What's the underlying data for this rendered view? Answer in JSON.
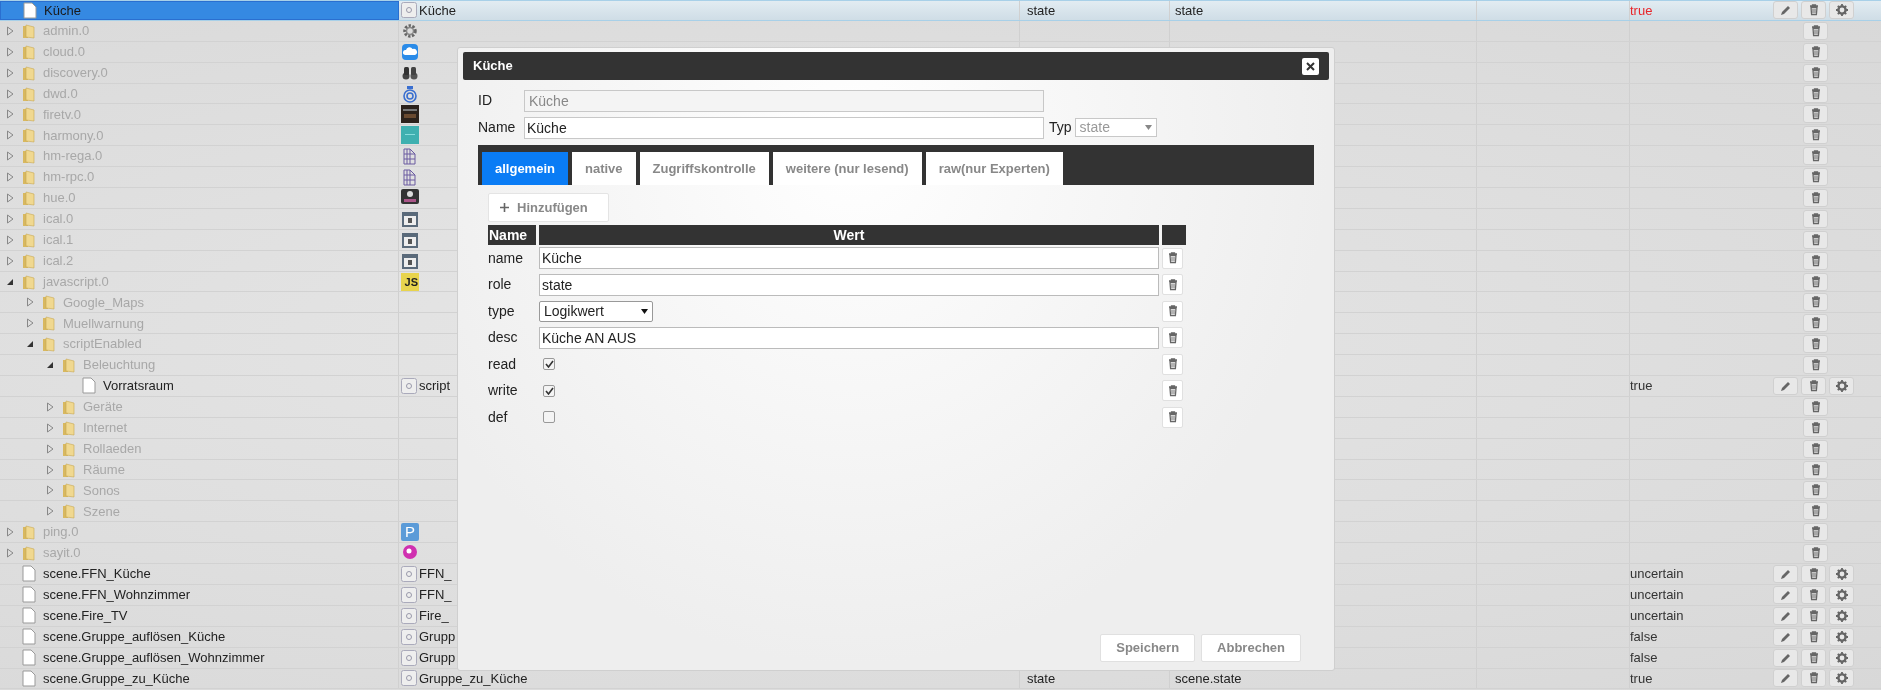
{
  "tree": [
    {
      "label": "Küche",
      "kind": "state",
      "selected": true,
      "name": "Küche",
      "type": "state",
      "role": "state",
      "value": "true",
      "color": "#e8262b"
    },
    {
      "label": "admin.0",
      "kind": "folder",
      "expanded": false,
      "selected": false
    },
    {
      "label": "cloud.0",
      "kind": "folder",
      "expanded": false,
      "selected": false
    },
    {
      "label": "discovery.0",
      "kind": "folder",
      "expanded": false,
      "selected": false
    },
    {
      "label": "dwd.0",
      "kind": "folder",
      "expanded": false,
      "selected": false
    },
    {
      "label": "firetv.0",
      "kind": "folder",
      "expanded": false,
      "selected": false
    },
    {
      "label": "harmony.0",
      "kind": "folder",
      "expanded": false,
      "selected": false
    },
    {
      "label": "hm-rega.0",
      "kind": "folder",
      "expanded": false,
      "selected": false
    },
    {
      "label": "hm-rpc.0",
      "kind": "folder",
      "expanded": false,
      "selected": false
    },
    {
      "label": "hue.0",
      "kind": "folder",
      "expanded": false,
      "selected": false
    },
    {
      "label": "ical.0",
      "kind": "folder",
      "expanded": false,
      "selected": false
    },
    {
      "label": "ical.1",
      "kind": "folder",
      "expanded": false,
      "selected": false
    },
    {
      "label": "ical.2",
      "kind": "folder",
      "expanded": false,
      "selected": false
    },
    {
      "label": "javascript.0",
      "kind": "folder",
      "expanded": true,
      "selected": false,
      "badge": "JS",
      "children": [
        {
          "label": "Google_Maps",
          "kind": "folder",
          "expanded": false,
          "selected": false
        },
        {
          "label": "Muellwarnung",
          "kind": "folder",
          "expanded": false,
          "selected": false
        },
        {
          "label": "scriptEnabled",
          "kind": "folder",
          "expanded": true,
          "selected": false,
          "children": [
            {
              "label": "Beleuchtung",
              "kind": "folder",
              "expanded": true,
              "selected": false,
              "children": [
                {
                  "label": "Vorratsraum",
                  "kind": "state",
                  "selected": false,
                  "name": "script",
                  "value": "true",
                  "color": "#333333"
                }
              ]
            },
            {
              "label": "Geräte",
              "kind": "folder",
              "expanded": false,
              "selected": false
            },
            {
              "label": "Internet",
              "kind": "folder",
              "expanded": false,
              "selected": false
            },
            {
              "label": "Rollaeden",
              "kind": "folder",
              "expanded": false,
              "selected": false
            },
            {
              "label": "Räume",
              "kind": "folder",
              "expanded": false,
              "selected": false
            },
            {
              "label": "Sonos",
              "kind": "folder",
              "expanded": false,
              "selected": false
            },
            {
              "label": "Szene",
              "kind": "folder",
              "expanded": false,
              "selected": false
            }
          ]
        }
      ]
    },
    {
      "label": "ping.0",
      "kind": "folder",
      "expanded": false,
      "selected": false,
      "badge": "P"
    },
    {
      "label": "sayit.0",
      "kind": "folder",
      "expanded": false,
      "selected": false
    },
    {
      "label": "scene.FFN_Küche",
      "kind": "state",
      "selected": false,
      "name": "FFN_",
      "value": "uncertain",
      "color": "#333333"
    },
    {
      "label": "scene.FFN_Wohnzimmer",
      "kind": "state",
      "selected": false,
      "name": "FFN_",
      "value": "uncertain",
      "color": "#333333"
    },
    {
      "label": "scene.Fire_TV",
      "kind": "state",
      "selected": false,
      "name": "Fire_",
      "value": "uncertain",
      "color": "#333333"
    },
    {
      "label": "scene.Gruppe_auflösen_Küche",
      "kind": "state",
      "selected": false,
      "name": "Grupp",
      "value": "false",
      "color": "#333333"
    },
    {
      "label": "scene.Gruppe_auflösen_Wohnzimmer",
      "kind": "state",
      "selected": false,
      "name": "Grupp",
      "value": "false",
      "color": "#333333"
    },
    {
      "label": "scene.Gruppe_zu_Küche",
      "kind": "state",
      "selected": false,
      "name": "Gruppe_zu_Küche",
      "type": "state",
      "role": "scene.state",
      "value": "true",
      "color": "#333333"
    }
  ],
  "dialog": {
    "title": "Küche",
    "id_label": "ID",
    "id_value": "Küche",
    "name_label": "Name",
    "name_value": "Küche",
    "typ_label": "Typ",
    "typ_value": "state",
    "tabs": [
      {
        "label": "allgemein",
        "selected": true
      },
      {
        "label": "native",
        "selected": false
      },
      {
        "label": "Zugriffskontrolle",
        "selected": false
      },
      {
        "label": "weitere (nur lesend)",
        "selected": false
      },
      {
        "label": "raw(nur Experten)",
        "selected": false
      }
    ],
    "add_button": "Hinzufügen",
    "columns": [
      "Name",
      "Wert"
    ],
    "fields": [
      {
        "name": "name",
        "kind": "text",
        "value": "Küche"
      },
      {
        "name": "role",
        "kind": "text",
        "value": "state"
      },
      {
        "name": "type",
        "kind": "select",
        "value": "Logikwert"
      },
      {
        "name": "desc",
        "kind": "text",
        "value": "Küche AN AUS"
      },
      {
        "name": "read",
        "kind": "checkbox",
        "checked": true
      },
      {
        "name": "write",
        "kind": "checkbox",
        "checked": true
      },
      {
        "name": "def",
        "kind": "checkbox",
        "checked": false
      }
    ],
    "buttons": [
      "Speichern",
      "Abbrechen"
    ]
  }
}
